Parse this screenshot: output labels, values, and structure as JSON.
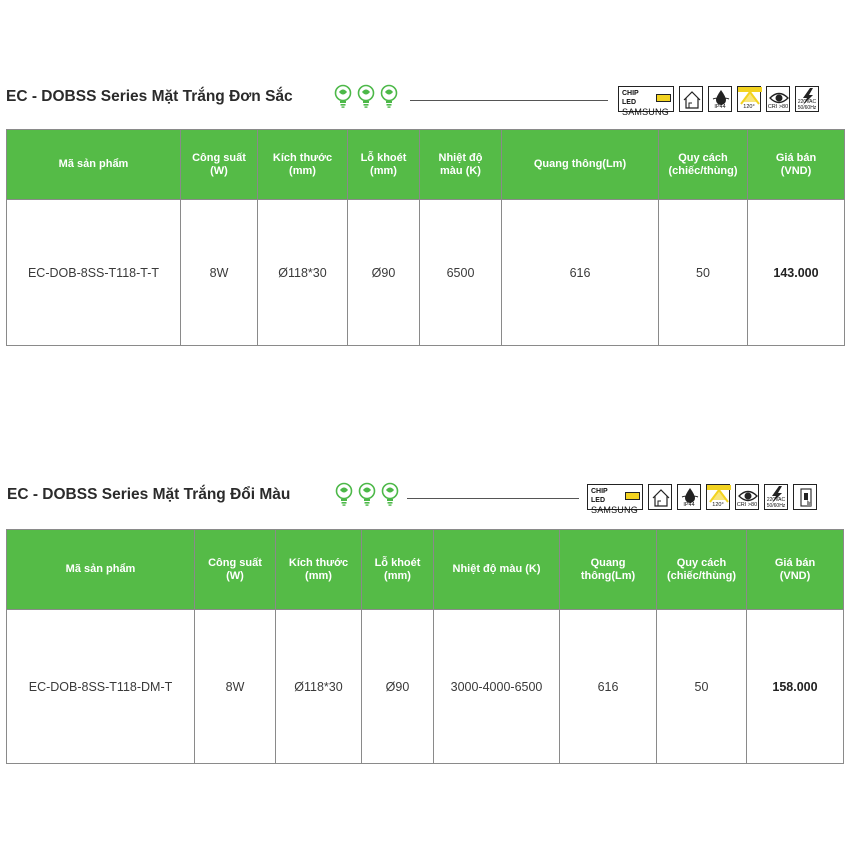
{
  "sections": [
    {
      "title": "EC - DOBSS Series Mặt Trắng Đơn Sắc",
      "headers": [
        [
          "Mã sản phẩm"
        ],
        [
          "Công suất",
          "(W)"
        ],
        [
          "Kích thước",
          "(mm)"
        ],
        [
          "Lỗ khoét",
          "(mm)"
        ],
        [
          "Nhiệt độ",
          "màu (K)"
        ],
        [
          "Quang thông(Lm)"
        ],
        [
          "Quy cách",
          "(chiếc/thùng)"
        ],
        [
          "Giá bán",
          "(VND)"
        ]
      ],
      "row": [
        "EC-DOB-8SS-T118-T-T",
        "8W",
        "Ø118*30",
        "Ø90",
        "6500",
        "616",
        "50",
        "143.000"
      ]
    },
    {
      "title": "EC - DOBSS Series Mặt Trắng Đổi Màu",
      "headers": [
        [
          "Mã sản phẩm"
        ],
        [
          "Công suất",
          "(W)"
        ],
        [
          "Kích thước",
          "(mm)"
        ],
        [
          "Lỗ khoét",
          "(mm)"
        ],
        [
          "Nhiệt độ màu (K)"
        ],
        [
          "Quang",
          "thông(Lm)"
        ],
        [
          "Quy cách",
          "(chiếc/thùng)"
        ],
        [
          "Giá bán",
          "(VND)"
        ]
      ],
      "row": [
        "EC-DOB-8SS-T118-DM-T",
        "8W",
        "Ø118*30",
        "Ø90",
        "3000-4000-6500",
        "616",
        "50",
        "158.000"
      ]
    }
  ],
  "cert": {
    "chip_top": "CHIP LED",
    "chip_brand": "SAMSUNG",
    "ip": "IP44",
    "angle": "120°",
    "cri": "CRI >80",
    "voltage_1": "220VAC",
    "voltage_2": "50/60Hz"
  },
  "colors": {
    "header_green": "#55bb47",
    "bulb_green": "#4cb848",
    "chip_yellow": "#f3d320"
  },
  "icons": [
    "energy-bulb-icon",
    "indoor-home-icon",
    "ip44-water-icon",
    "beam-angle-icon",
    "cri-eye-icon",
    "voltage-lightning-icon",
    "wall-switch-icon"
  ]
}
